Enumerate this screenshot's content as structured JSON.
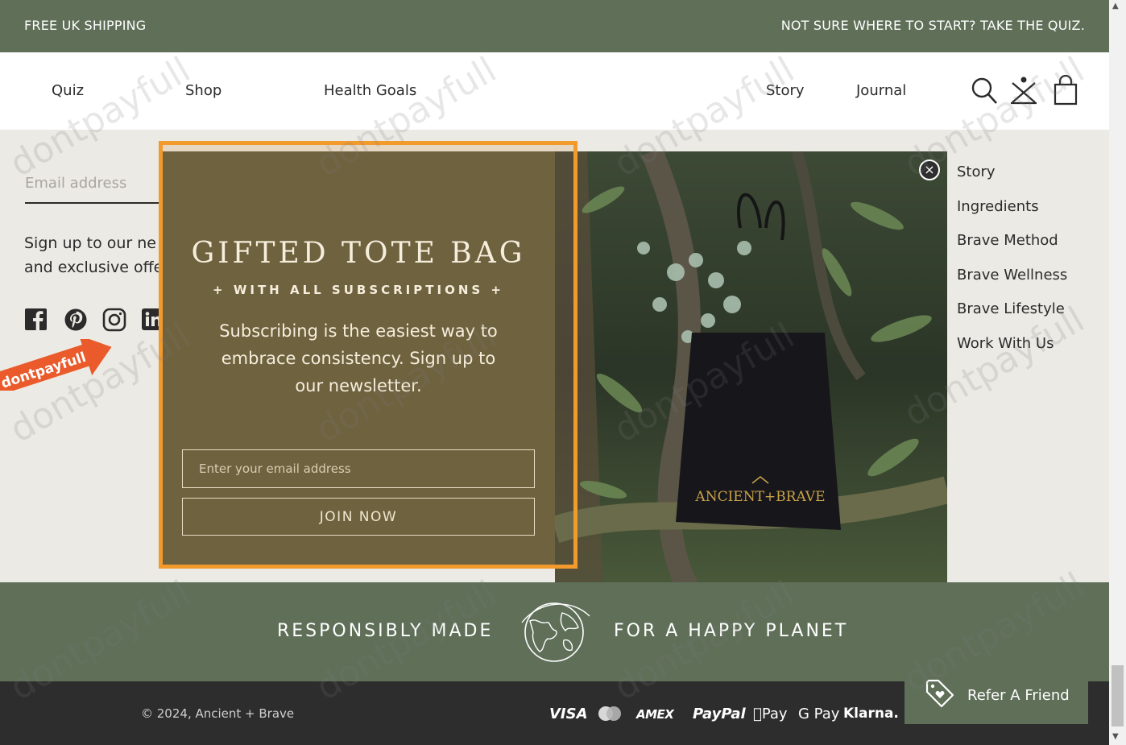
{
  "topbar": {
    "left": "FREE UK SHIPPING",
    "right": "NOT SURE WHERE TO START? TAKE THE QUIZ."
  },
  "nav": {
    "items": [
      "Quiz",
      "Shop",
      "Health Goals",
      "Story",
      "Journal"
    ]
  },
  "footer": {
    "email_placeholder": "Email address",
    "signup_line1": "Sign up to our ne",
    "signup_line2": "and exclusive offe",
    "links": [
      "Story",
      "Ingredients",
      "Brave Method",
      "Brave Wellness",
      "Brave Lifestyle",
      "Work With Us"
    ]
  },
  "popup": {
    "title": "GIFTED TOTE BAG",
    "subtitle": "+ WITH ALL SUBSCRIPTIONS +",
    "body": "Subscribing is the easiest way to embrace consistency. Sign up to our newsletter.",
    "input_placeholder": "Enter your email address",
    "button": "JOIN NOW",
    "close": "×",
    "bag_brand": "ANCIENT+BRAVE"
  },
  "band": {
    "left": "RESPONSIBLY MADE",
    "right": "FOR A HAPPY PLANET"
  },
  "bottom": {
    "copyright": "© 2024, Ancient + Brave",
    "payments": [
      "VISA",
      "AMEX",
      "PayPal",
      "Pay",
      "G Pay",
      "Klarna."
    ]
  },
  "refer": {
    "label": "Refer A Friend"
  },
  "watermark": {
    "text": "dontpayfull",
    "ribbon": "dontpayfull"
  },
  "colors": {
    "brand_green": "#5f6f58",
    "popup_brown": "#6f623f",
    "highlight_orange": "#f39a2c"
  }
}
